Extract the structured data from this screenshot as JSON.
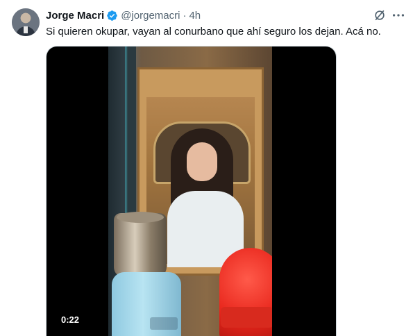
{
  "author": {
    "display_name": "Jorge Macri",
    "handle": "@jorgemacri",
    "separator": "·",
    "timestamp": "4h",
    "verified_icon": "verified-badge-icon"
  },
  "tweet": {
    "text": "Si quieren okupar, vayan al conurbano que ahí seguro los dejan. Acá no."
  },
  "media": {
    "type": "video",
    "duration": "0:22"
  },
  "icons": {
    "grok": "grok-icon",
    "more": "more-options-icon"
  },
  "colors": {
    "verified_blue": "#1d9bf0",
    "secondary_text": "#536471",
    "primary_text": "#0f1419"
  }
}
